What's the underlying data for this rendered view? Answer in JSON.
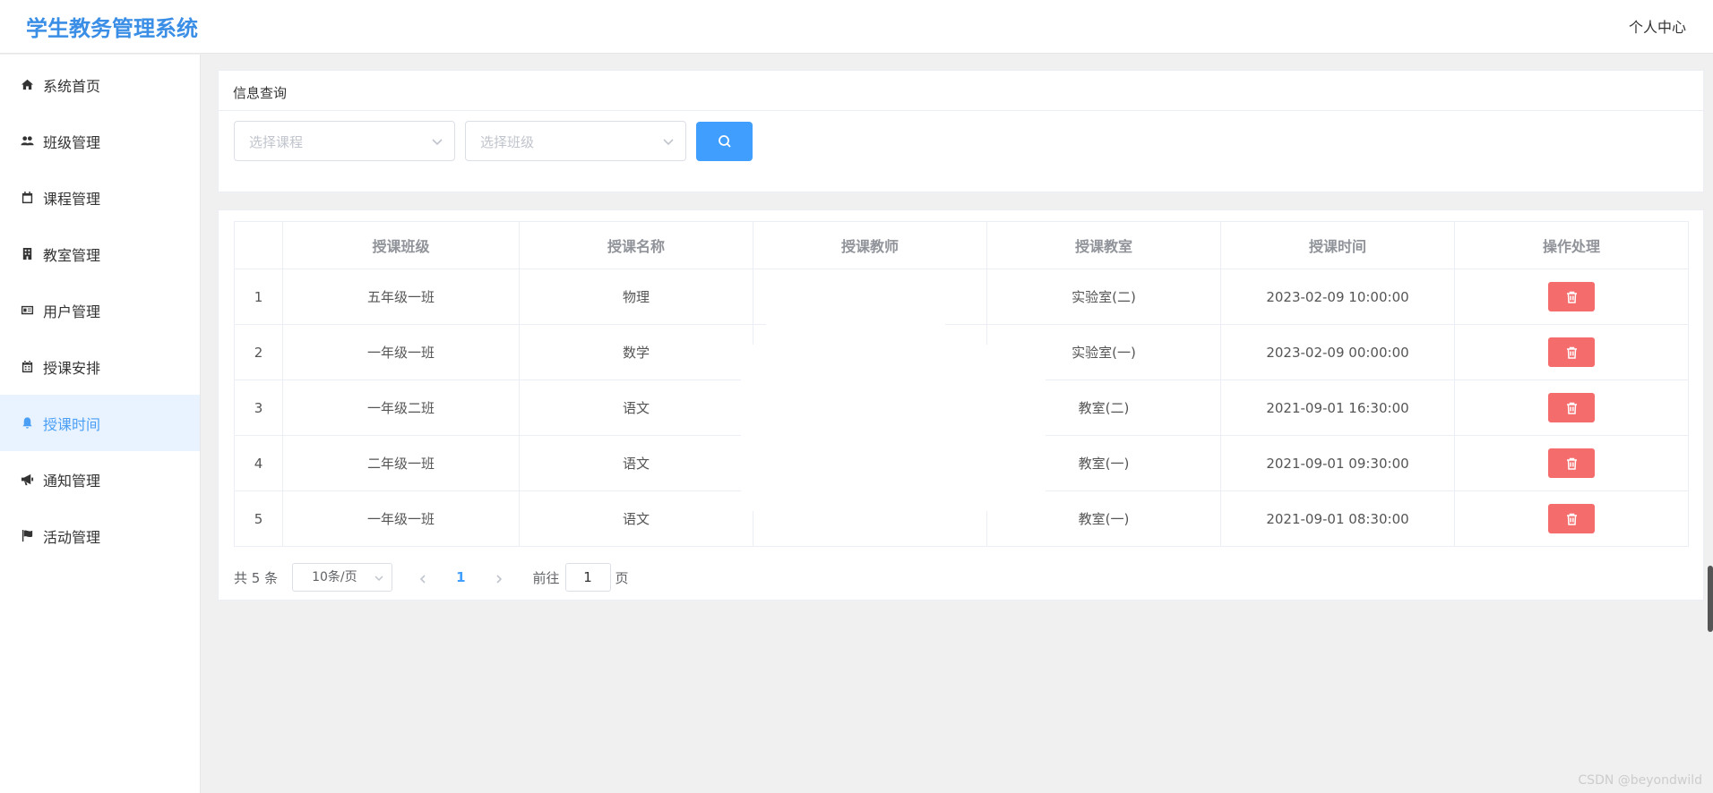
{
  "header": {
    "title": "学生教务管理系统",
    "user_center": "个人中心"
  },
  "sidebar": {
    "items": [
      {
        "label": "系统首页",
        "icon": "home-icon"
      },
      {
        "label": "班级管理",
        "icon": "users-icon"
      },
      {
        "label": "课程管理",
        "icon": "calendar-icon"
      },
      {
        "label": "教室管理",
        "icon": "building-icon"
      },
      {
        "label": "用户管理",
        "icon": "id-card-icon"
      },
      {
        "label": "授课安排",
        "icon": "calendar-grid-icon"
      },
      {
        "label": "授课时间",
        "icon": "bell-icon",
        "active": true
      },
      {
        "label": "通知管理",
        "icon": "bullhorn-icon"
      },
      {
        "label": "活动管理",
        "icon": "flag-icon"
      }
    ]
  },
  "query": {
    "title": "信息查询",
    "course_placeholder": "选择课程",
    "class_placeholder": "选择班级"
  },
  "table": {
    "headers": [
      "",
      "授课班级",
      "授课名称",
      "授课教师",
      "授课教室",
      "授课时间",
      "操作处理"
    ],
    "rows": [
      {
        "idx": "1",
        "class": "五年级一班",
        "course": "物理",
        "teacher": "",
        "room": "实验室(二)",
        "time": "2023-02-09 10:00:00"
      },
      {
        "idx": "2",
        "class": "一年级一班",
        "course": "数学",
        "teacher": "",
        "room": "实验室(一)",
        "time": "2023-02-09 00:00:00"
      },
      {
        "idx": "3",
        "class": "一年级二班",
        "course": "语文",
        "teacher": "",
        "room": "教室(二)",
        "time": "2021-09-01 16:30:00"
      },
      {
        "idx": "4",
        "class": "二年级一班",
        "course": "语文",
        "teacher": "",
        "room": "教室(一)",
        "time": "2021-09-01 09:30:00"
      },
      {
        "idx": "5",
        "class": "一年级一班",
        "course": "语文",
        "teacher": "",
        "room": "教室(一)",
        "time": "2021-09-01 08:30:00"
      }
    ]
  },
  "pagination": {
    "total": "共 5 条",
    "page_size": "10条/页",
    "current_page": "1",
    "goto_label": "前往",
    "goto_value": "1",
    "page_suffix": "页"
  },
  "watermark": "CSDN @beyondwild",
  "colors": {
    "brand": "#3a8ee6",
    "primary": "#409eff",
    "danger": "#f56c6c",
    "active_bg": "#e8f3ff"
  }
}
